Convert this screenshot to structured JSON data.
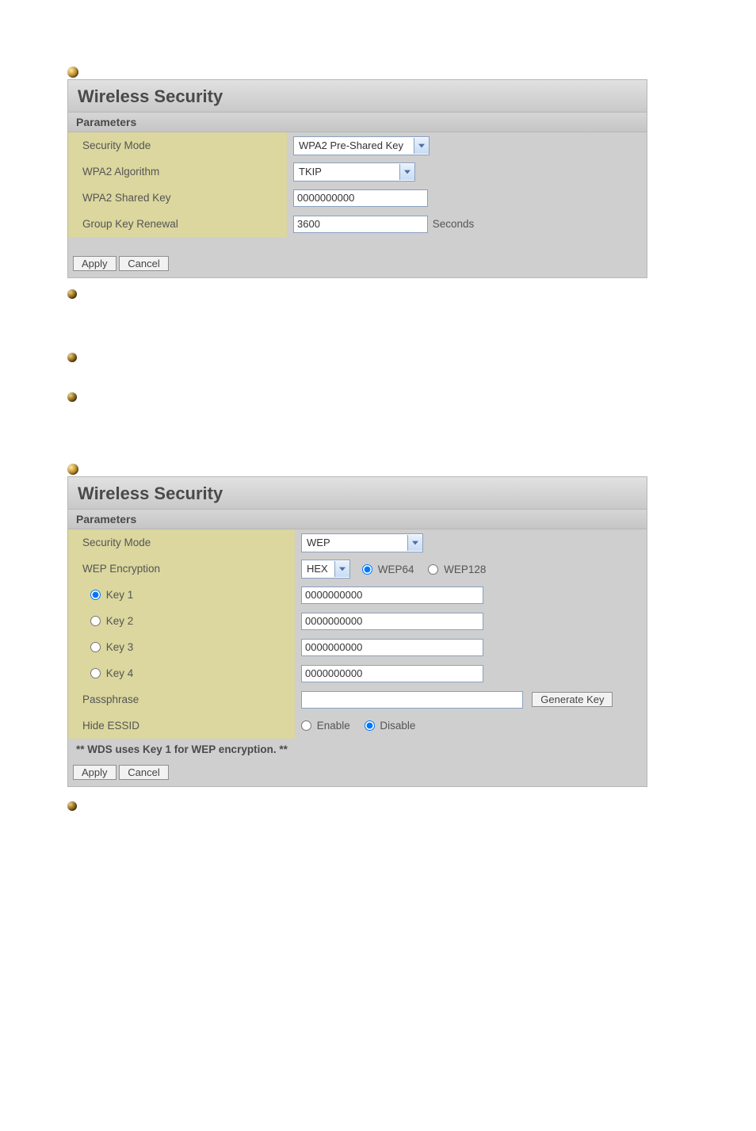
{
  "panel1": {
    "title": "Wireless Security",
    "subheader": "Parameters",
    "rows": {
      "securityMode": {
        "label": "Security Mode",
        "value": "WPA2 Pre-Shared Key"
      },
      "wpa2Algorithm": {
        "label": "WPA2 Algorithm",
        "value": "TKIP"
      },
      "wpa2SharedKey": {
        "label": "WPA2 Shared Key",
        "value": "0000000000"
      },
      "groupKeyRenewal": {
        "label": "Group Key Renewal",
        "value": "3600",
        "suffix": "Seconds"
      }
    },
    "buttons": {
      "apply": "Apply",
      "cancel": "Cancel"
    }
  },
  "panel2": {
    "title": "Wireless Security",
    "subheader": "Parameters",
    "rows": {
      "securityMode": {
        "label": "Security Mode",
        "value": "WEP"
      },
      "wepEncryption": {
        "label": "WEP Encryption",
        "format": "HEX",
        "opts": {
          "wep64": "WEP64",
          "wep128": "WEP128"
        }
      },
      "key1": {
        "label": "Key 1",
        "value": "0000000000"
      },
      "key2": {
        "label": "Key 2",
        "value": "0000000000"
      },
      "key3": {
        "label": "Key 3",
        "value": "0000000000"
      },
      "key4": {
        "label": "Key 4",
        "value": "0000000000"
      },
      "passphrase": {
        "label": "Passphrase",
        "value": "",
        "generate": "Generate Key"
      },
      "hideEssid": {
        "label": "Hide ESSID",
        "enable": "Enable",
        "disable": "Disable"
      }
    },
    "note": "** WDS uses Key 1 for WEP encryption. **",
    "buttons": {
      "apply": "Apply",
      "cancel": "Cancel"
    }
  }
}
